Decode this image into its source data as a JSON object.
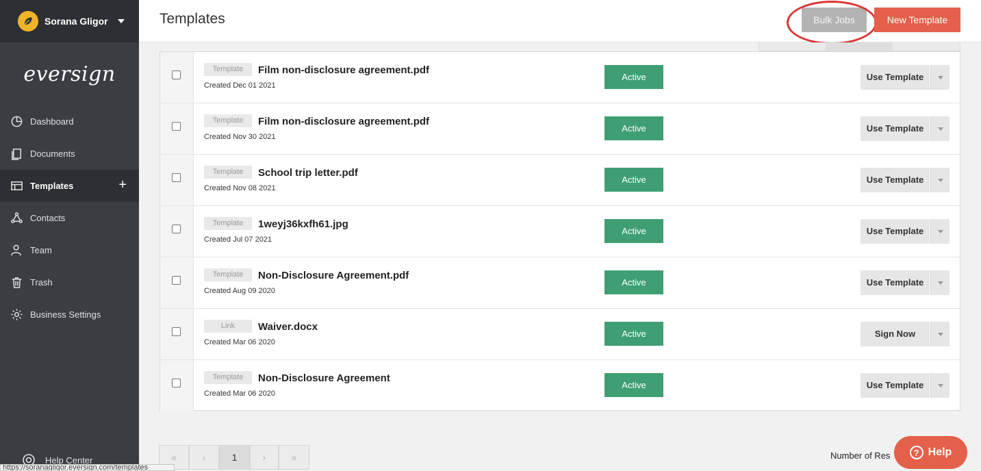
{
  "user": {
    "name": "Sorana Gligor"
  },
  "logo": {
    "text": "eversign"
  },
  "sidebar": {
    "items": [
      {
        "label": "Dashboard",
        "icon": "pie-chart-icon"
      },
      {
        "label": "Documents",
        "icon": "documents-icon"
      },
      {
        "label": "Templates",
        "icon": "templates-icon",
        "active": true
      },
      {
        "label": "Contacts",
        "icon": "contacts-icon"
      },
      {
        "label": "Team",
        "icon": "team-icon"
      },
      {
        "label": "Trash",
        "icon": "trash-icon"
      },
      {
        "label": "Business Settings",
        "icon": "gear-icon"
      }
    ],
    "add_symbol": "+",
    "help_center": "Help Center"
  },
  "header": {
    "title": "Templates",
    "bulk_jobs_label": "Bulk Jobs",
    "new_template_label": "New Template"
  },
  "rows": [
    {
      "type": "Template",
      "name": "Film non-disclosure agreement.pdf",
      "created": "Created Dec 01 2021",
      "status": "Active",
      "action": "Use Template"
    },
    {
      "type": "Template",
      "name": "Film non-disclosure agreement.pdf",
      "created": "Created Nov 30 2021",
      "status": "Active",
      "action": "Use Template"
    },
    {
      "type": "Template",
      "name": "School trip letter.pdf",
      "created": "Created Nov 08 2021",
      "status": "Active",
      "action": "Use Template"
    },
    {
      "type": "Template",
      "name": "1weyj36kxfh61.jpg",
      "created": "Created Jul 07 2021",
      "status": "Active",
      "action": "Use Template"
    },
    {
      "type": "Template",
      "name": "Non-Disclosure Agreement.pdf",
      "created": "Created Aug 09 2020",
      "status": "Active",
      "action": "Use Template"
    },
    {
      "type": "Link",
      "name": "Waiver.docx",
      "created": "Created Mar 06 2020",
      "status": "Active",
      "action": "Sign Now"
    },
    {
      "type": "Template",
      "name": "Non-Disclosure Agreement",
      "created": "Created Mar 06 2020",
      "status": "Active",
      "action": "Use Template"
    }
  ],
  "pagination": {
    "first": "«",
    "prev": "‹",
    "current": "1",
    "next": "›",
    "last": "»"
  },
  "number_of_results_label": "Number of Res",
  "help_button": {
    "label": "Help",
    "symbol": "?"
  },
  "status_url": "https://soranagligor.eversign.com/templates",
  "colors": {
    "accent": "#e4604a",
    "active_status": "#3f9f72",
    "sidebar": "#3a3d42",
    "annotation": "#d93636"
  }
}
